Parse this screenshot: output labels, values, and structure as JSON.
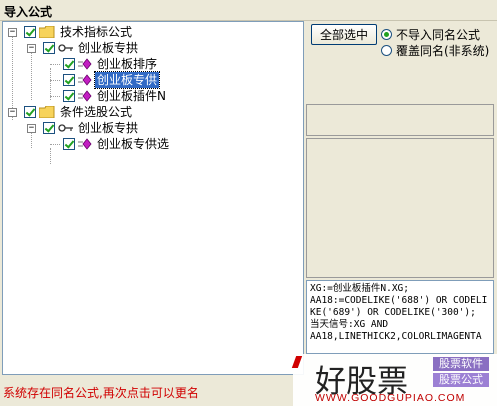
{
  "window": {
    "title": "导入公式"
  },
  "tree": {
    "nodes": [
      {
        "label": "技术指标公式",
        "level": 0,
        "type": "folder"
      },
      {
        "label": "创业板专拱",
        "level": 1,
        "type": "key"
      },
      {
        "label": "创业板排序",
        "level": 2,
        "type": "formula"
      },
      {
        "label": "创业板专供",
        "level": 2,
        "type": "formula",
        "selected": true
      },
      {
        "label": "创业板插件N",
        "level": 2,
        "type": "formula"
      },
      {
        "label": "条件选股公式",
        "level": 0,
        "type": "folder"
      },
      {
        "label": "创业板专拱",
        "level": 1,
        "type": "key"
      },
      {
        "label": "创业板专供选",
        "level": 2,
        "type": "formula"
      }
    ]
  },
  "controls": {
    "select_all": "全部选中",
    "options": [
      "不导入同名公式",
      "覆盖同名(非系统)"
    ],
    "selected_option": 0
  },
  "code": "XG:=创业板插件N.XG;\nAA18:=CODELIKE('688') OR CODELIKE('689') OR CODELIKE('300');\n当天信号:XG AND\nAA18,LINETHICK2,COLORLIMAGENTA",
  "status": "系统存在同名公式,再次点击可以更名",
  "watermark": {
    "brand": "好股票",
    "tag1": "股票软件",
    "tag2": "股票公式",
    "url": "WWW.GOODGUPIAO.COM"
  },
  "colors": {
    "selection": "#316ac5",
    "status_text": "#d00000",
    "check": "#21a121"
  }
}
